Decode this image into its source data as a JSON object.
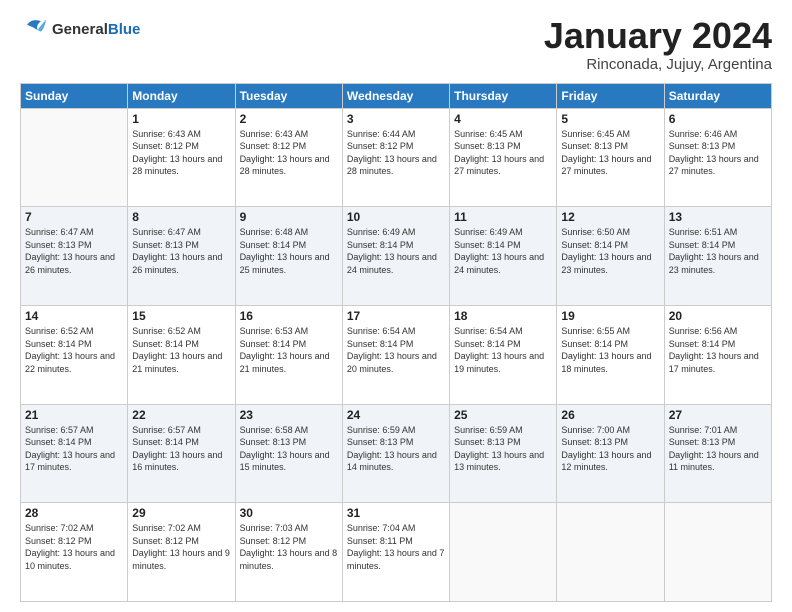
{
  "logo": {
    "general": "General",
    "blue": "Blue"
  },
  "header": {
    "month": "January 2024",
    "location": "Rinconada, Jujuy, Argentina"
  },
  "weekdays": [
    "Sunday",
    "Monday",
    "Tuesday",
    "Wednesday",
    "Thursday",
    "Friday",
    "Saturday"
  ],
  "weeks": [
    [
      {
        "day": "",
        "info": ""
      },
      {
        "day": "1",
        "info": "Sunrise: 6:43 AM\nSunset: 8:12 PM\nDaylight: 13 hours and 28 minutes."
      },
      {
        "day": "2",
        "info": "Sunrise: 6:43 AM\nSunset: 8:12 PM\nDaylight: 13 hours and 28 minutes."
      },
      {
        "day": "3",
        "info": "Sunrise: 6:44 AM\nSunset: 8:12 PM\nDaylight: 13 hours and 28 minutes."
      },
      {
        "day": "4",
        "info": "Sunrise: 6:45 AM\nSunset: 8:13 PM\nDaylight: 13 hours and 27 minutes."
      },
      {
        "day": "5",
        "info": "Sunrise: 6:45 AM\nSunset: 8:13 PM\nDaylight: 13 hours and 27 minutes."
      },
      {
        "day": "6",
        "info": "Sunrise: 6:46 AM\nSunset: 8:13 PM\nDaylight: 13 hours and 27 minutes."
      }
    ],
    [
      {
        "day": "7",
        "info": "Sunrise: 6:47 AM\nSunset: 8:13 PM\nDaylight: 13 hours and 26 minutes."
      },
      {
        "day": "8",
        "info": "Sunrise: 6:47 AM\nSunset: 8:13 PM\nDaylight: 13 hours and 26 minutes."
      },
      {
        "day": "9",
        "info": "Sunrise: 6:48 AM\nSunset: 8:14 PM\nDaylight: 13 hours and 25 minutes."
      },
      {
        "day": "10",
        "info": "Sunrise: 6:49 AM\nSunset: 8:14 PM\nDaylight: 13 hours and 24 minutes."
      },
      {
        "day": "11",
        "info": "Sunrise: 6:49 AM\nSunset: 8:14 PM\nDaylight: 13 hours and 24 minutes."
      },
      {
        "day": "12",
        "info": "Sunrise: 6:50 AM\nSunset: 8:14 PM\nDaylight: 13 hours and 23 minutes."
      },
      {
        "day": "13",
        "info": "Sunrise: 6:51 AM\nSunset: 8:14 PM\nDaylight: 13 hours and 23 minutes."
      }
    ],
    [
      {
        "day": "14",
        "info": "Sunrise: 6:52 AM\nSunset: 8:14 PM\nDaylight: 13 hours and 22 minutes."
      },
      {
        "day": "15",
        "info": "Sunrise: 6:52 AM\nSunset: 8:14 PM\nDaylight: 13 hours and 21 minutes."
      },
      {
        "day": "16",
        "info": "Sunrise: 6:53 AM\nSunset: 8:14 PM\nDaylight: 13 hours and 21 minutes."
      },
      {
        "day": "17",
        "info": "Sunrise: 6:54 AM\nSunset: 8:14 PM\nDaylight: 13 hours and 20 minutes."
      },
      {
        "day": "18",
        "info": "Sunrise: 6:54 AM\nSunset: 8:14 PM\nDaylight: 13 hours and 19 minutes."
      },
      {
        "day": "19",
        "info": "Sunrise: 6:55 AM\nSunset: 8:14 PM\nDaylight: 13 hours and 18 minutes."
      },
      {
        "day": "20",
        "info": "Sunrise: 6:56 AM\nSunset: 8:14 PM\nDaylight: 13 hours and 17 minutes."
      }
    ],
    [
      {
        "day": "21",
        "info": "Sunrise: 6:57 AM\nSunset: 8:14 PM\nDaylight: 13 hours and 17 minutes."
      },
      {
        "day": "22",
        "info": "Sunrise: 6:57 AM\nSunset: 8:14 PM\nDaylight: 13 hours and 16 minutes."
      },
      {
        "day": "23",
        "info": "Sunrise: 6:58 AM\nSunset: 8:13 PM\nDaylight: 13 hours and 15 minutes."
      },
      {
        "day": "24",
        "info": "Sunrise: 6:59 AM\nSunset: 8:13 PM\nDaylight: 13 hours and 14 minutes."
      },
      {
        "day": "25",
        "info": "Sunrise: 6:59 AM\nSunset: 8:13 PM\nDaylight: 13 hours and 13 minutes."
      },
      {
        "day": "26",
        "info": "Sunrise: 7:00 AM\nSunset: 8:13 PM\nDaylight: 13 hours and 12 minutes."
      },
      {
        "day": "27",
        "info": "Sunrise: 7:01 AM\nSunset: 8:13 PM\nDaylight: 13 hours and 11 minutes."
      }
    ],
    [
      {
        "day": "28",
        "info": "Sunrise: 7:02 AM\nSunset: 8:12 PM\nDaylight: 13 hours and 10 minutes."
      },
      {
        "day": "29",
        "info": "Sunrise: 7:02 AM\nSunset: 8:12 PM\nDaylight: 13 hours and 9 minutes."
      },
      {
        "day": "30",
        "info": "Sunrise: 7:03 AM\nSunset: 8:12 PM\nDaylight: 13 hours and 8 minutes."
      },
      {
        "day": "31",
        "info": "Sunrise: 7:04 AM\nSunset: 8:11 PM\nDaylight: 13 hours and 7 minutes."
      },
      {
        "day": "",
        "info": ""
      },
      {
        "day": "",
        "info": ""
      },
      {
        "day": "",
        "info": ""
      }
    ]
  ]
}
